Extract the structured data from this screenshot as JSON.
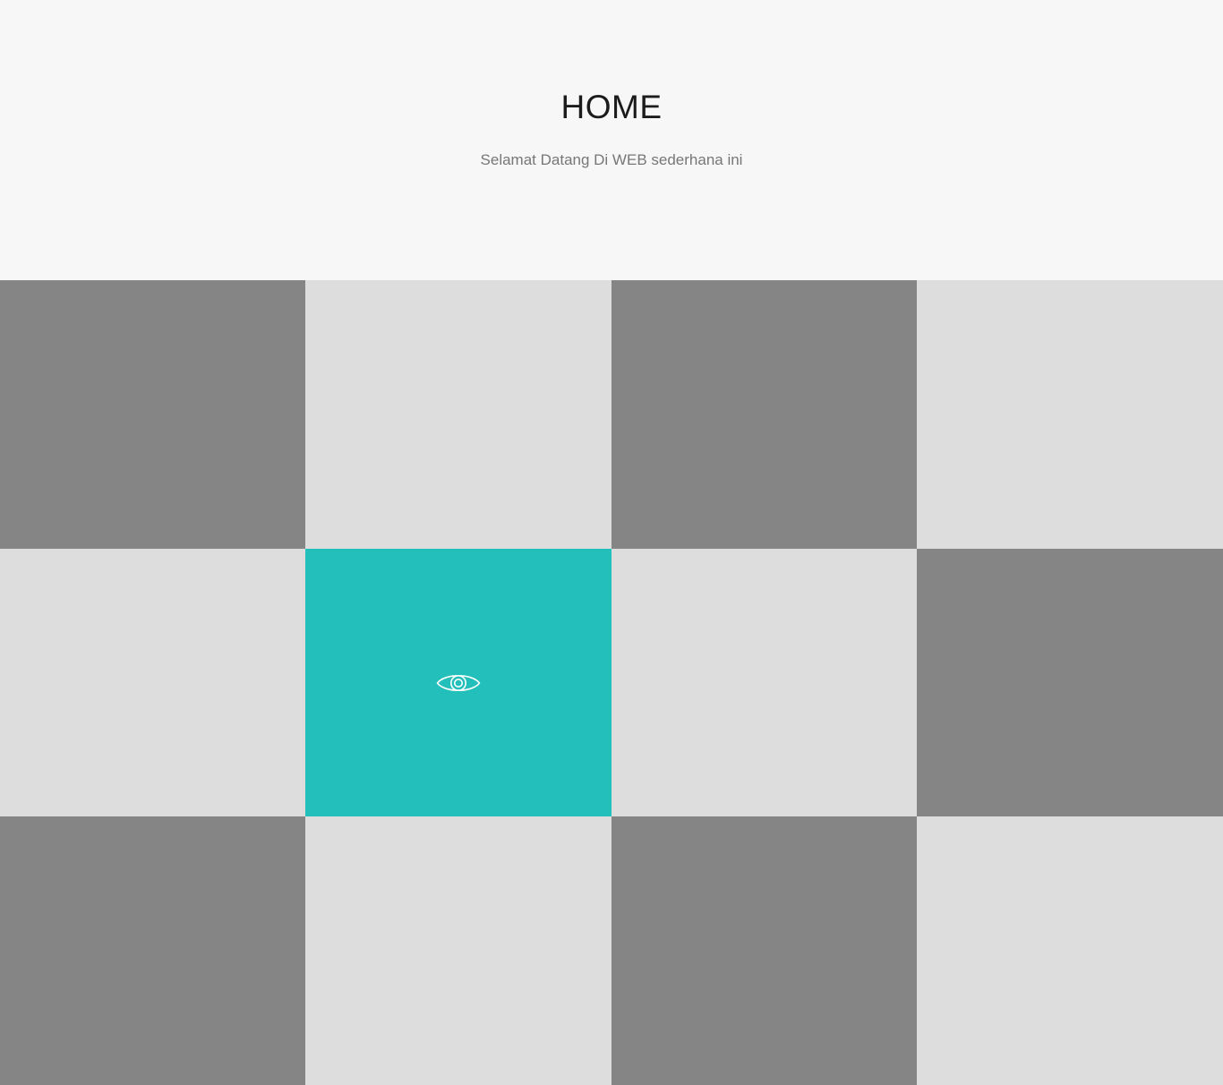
{
  "hero": {
    "title": "HOME",
    "subtitle": "Selamat Datang Di WEB sederhana ini"
  },
  "gallery": {
    "tiles": [
      {
        "tone": "dark",
        "icon": ""
      },
      {
        "tone": "light",
        "icon": ""
      },
      {
        "tone": "dark",
        "icon": ""
      },
      {
        "tone": "light",
        "icon": ""
      },
      {
        "tone": "light",
        "icon": ""
      },
      {
        "tone": "active",
        "icon": "eye-icon"
      },
      {
        "tone": "light",
        "icon": ""
      },
      {
        "tone": "dark",
        "icon": ""
      },
      {
        "tone": "dark",
        "icon": ""
      },
      {
        "tone": "light",
        "icon": ""
      },
      {
        "tone": "dark",
        "icon": ""
      },
      {
        "tone": "light",
        "icon": ""
      }
    ]
  },
  "colors": {
    "background": "#f7f7f7",
    "tile_dark": "#858585",
    "tile_light": "#dddddd",
    "tile_active": "#22bfbb",
    "title": "#1b1b1b",
    "subtitle": "#777777"
  }
}
